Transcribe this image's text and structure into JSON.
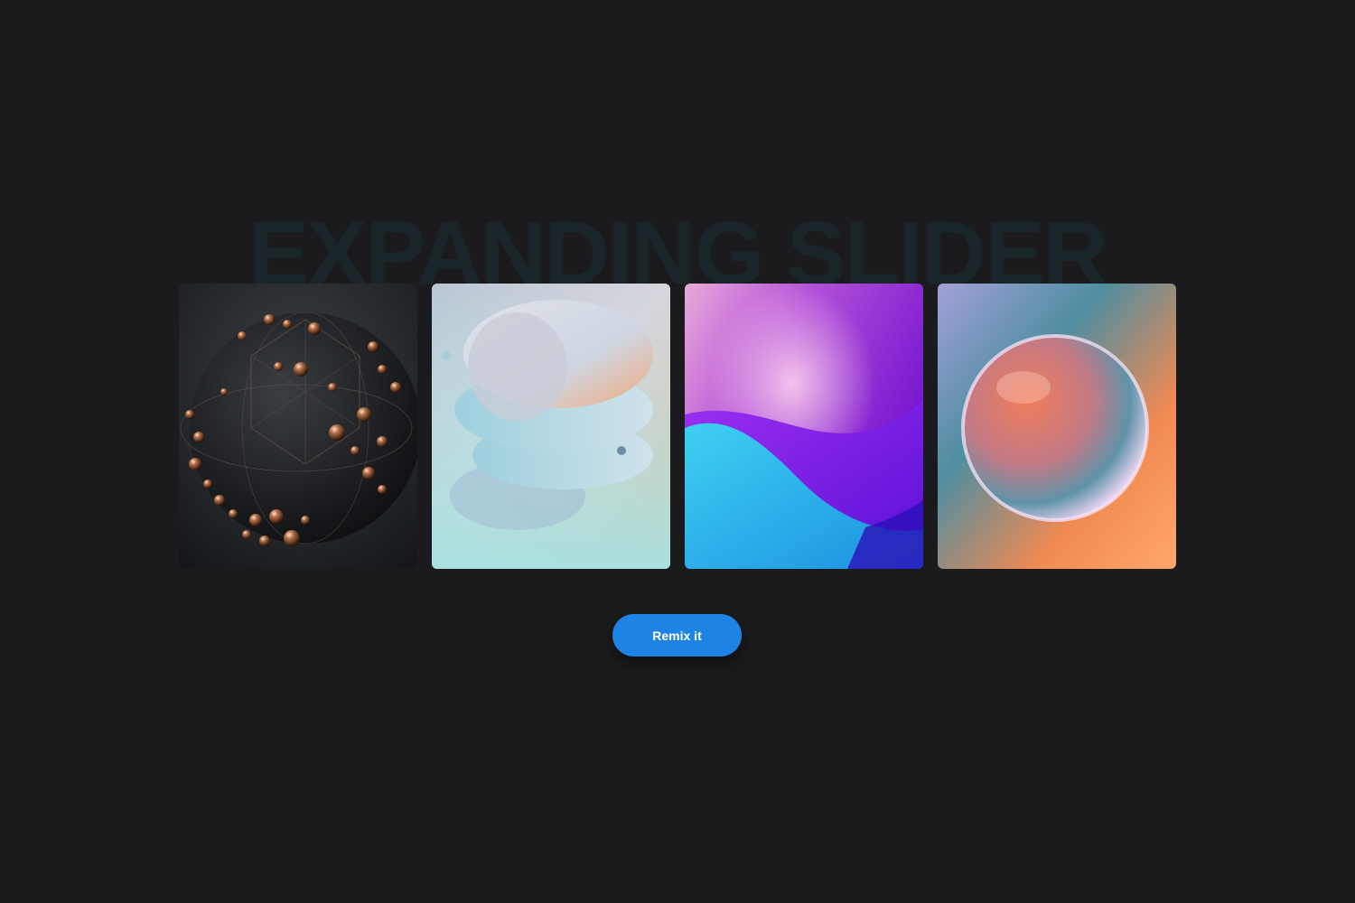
{
  "page": {
    "background_title": "EXPANDING SLIDER",
    "remix_button_label": "Remix it"
  },
  "slider": {
    "cards": [
      {
        "name": "dark-sphere-with-copper-beads",
        "icon": "image-icon"
      },
      {
        "name": "pastel-stacked-discs",
        "icon": "image-icon"
      },
      {
        "name": "purple-blue-waves",
        "icon": "image-icon"
      },
      {
        "name": "iridescent-bubble",
        "icon": "image-icon"
      }
    ]
  },
  "colors": {
    "background": "#1b1b1d",
    "title_text": "#1a2529",
    "button_bg": "#1d84e6",
    "button_text": "#ffffff"
  }
}
